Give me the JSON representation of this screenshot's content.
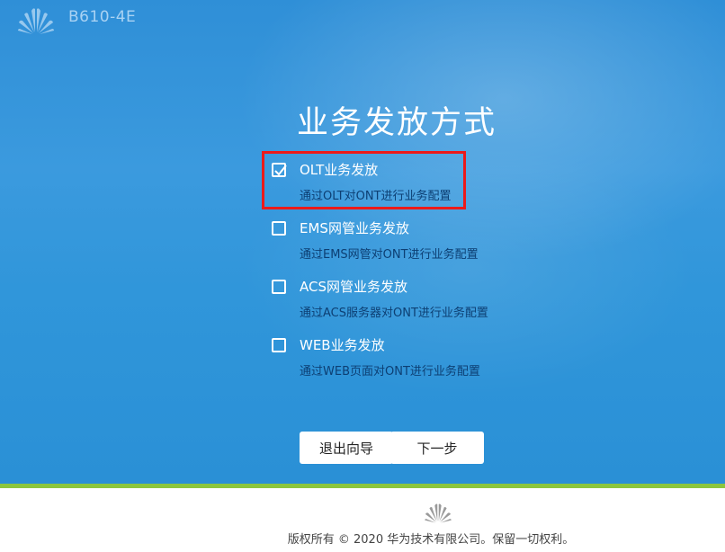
{
  "header": {
    "logo_icon": "huawei-logo-icon",
    "model_name": "B610-4E"
  },
  "page_title": "业务发放方式",
  "options": [
    {
      "label": "OLT业务发放",
      "description": "通过OLT对ONT进行业务配置",
      "checked": true
    },
    {
      "label": "EMS网管业务发放",
      "description": "通过EMS网管对ONT进行业务配置",
      "checked": false
    },
    {
      "label": "ACS网管业务发放",
      "description": "通过ACS服务器对ONT进行业务配置",
      "checked": false
    },
    {
      "label": "WEB业务发放",
      "description": "通过WEB页面对ONT进行业务配置",
      "checked": false
    }
  ],
  "buttons": {
    "exit_label": "退出向导",
    "next_label": "下一步"
  },
  "footer": {
    "logo_icon": "huawei-logo-icon",
    "copyright": "版权所有 © 2020 华为技术有限公司。保留一切权利。"
  },
  "colors": {
    "background_blue": "#3096da",
    "accent_green": "#8cc63e",
    "highlight_red": "#ec1a1a",
    "description_text": "#0d3f73"
  }
}
